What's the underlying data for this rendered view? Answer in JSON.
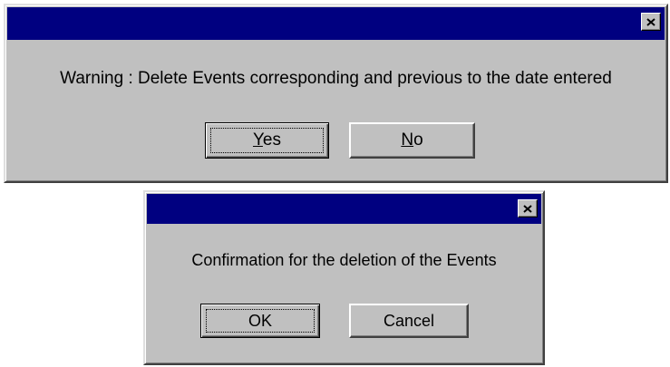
{
  "warning_dialog": {
    "title": "",
    "message": "Warning : Delete Events corresponding and previous to the date entered",
    "yes_button": {
      "mnemonic": "Y",
      "rest": "es"
    },
    "no_button": {
      "mnemonic": "N",
      "rest": "o"
    },
    "close_icon": "close-x-icon"
  },
  "confirm_dialog": {
    "title": "",
    "message": "Confirmation for the deletion of the Events",
    "ok_button": "OK",
    "cancel_button": "Cancel",
    "close_icon": "close-x-icon"
  },
  "colors": {
    "titlebar": "#000080",
    "dialog_face": "#c0c0c0",
    "background": "#ffffff"
  }
}
